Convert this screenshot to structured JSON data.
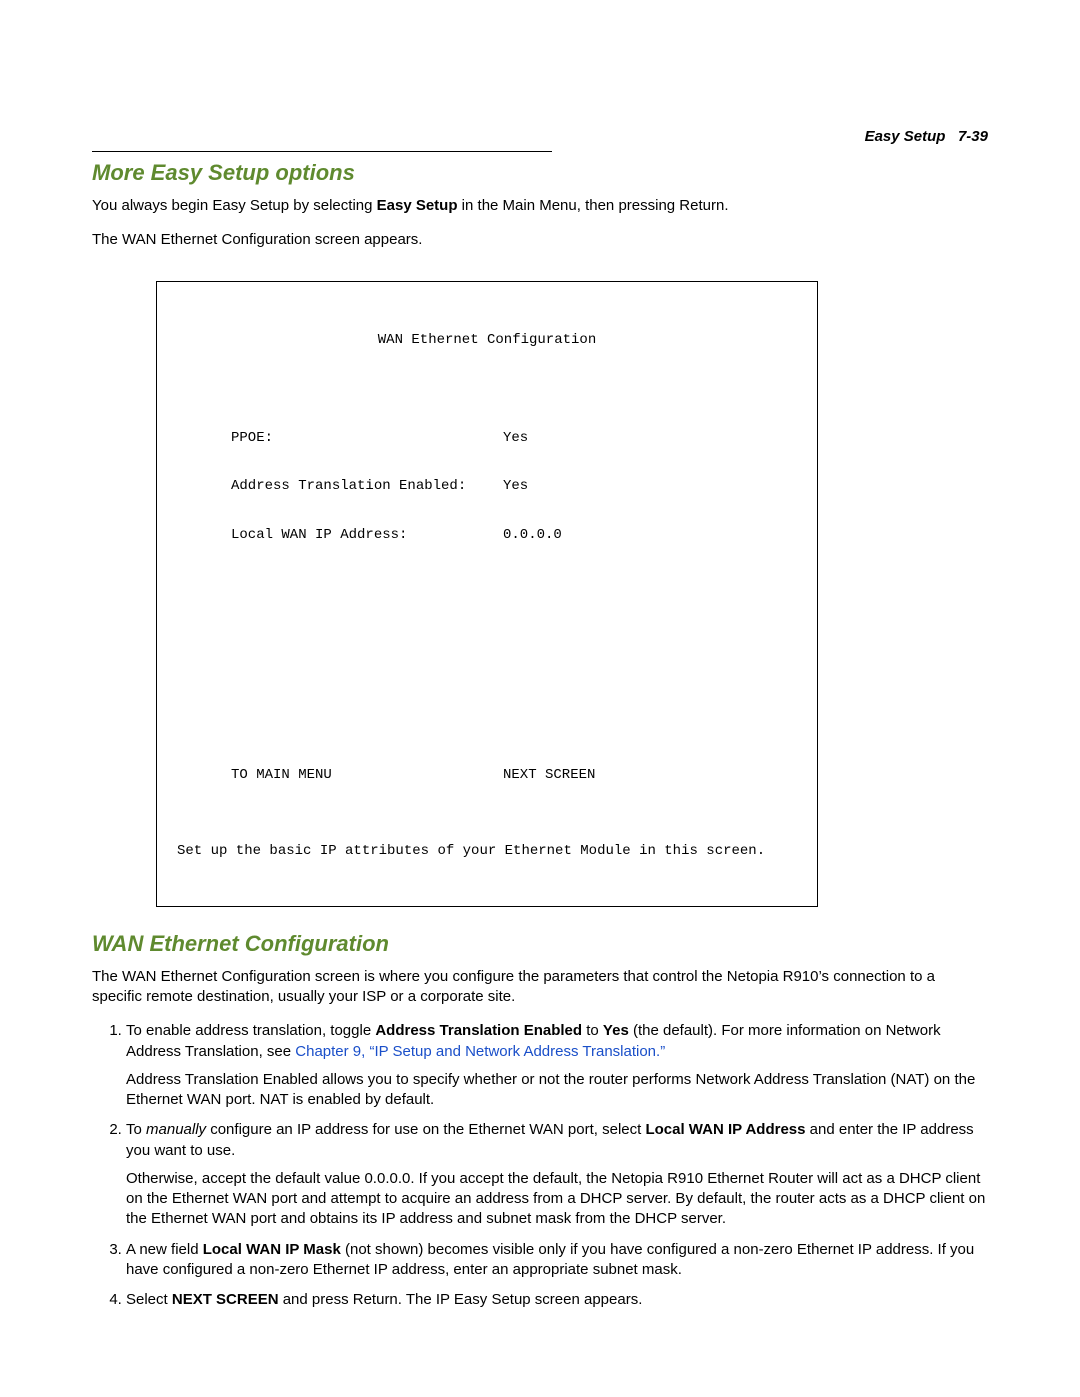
{
  "header": {
    "running_title": "Easy Setup",
    "page_ref": "7-39"
  },
  "section1": {
    "title": "More Easy Setup options",
    "p1a": "You always begin Easy Setup by selecting ",
    "p1b_bold": "Easy Setup",
    "p1c": " in the Main Menu, then pressing Return.",
    "p2": "The WAN Ethernet Configuration screen appears."
  },
  "terminal": {
    "title": "WAN Ethernet Configuration",
    "rows": [
      {
        "k": "PPOE:",
        "v": "Yes"
      },
      {
        "k": "Address Translation Enabled:",
        "v": "Yes"
      },
      {
        "k": "Local WAN IP Address:",
        "v": "0.0.0.0"
      }
    ],
    "nav_left": "TO MAIN MENU",
    "nav_right": "NEXT SCREEN",
    "footer": "Set up the basic IP attributes of your Ethernet Module in this screen."
  },
  "section2": {
    "title": "WAN Ethernet Configuration",
    "intro": "The WAN Ethernet Configuration screen is where you configure the parameters that control the Netopia R910’s connection to a specific remote destination, usually your ISP or a corporate site.",
    "item1": {
      "a": "To enable address translation, toggle ",
      "b_bold": "Address Translation Enabled",
      "c": " to ",
      "d_bold": "Yes",
      "e": " (the default). For more information on Network Address Translation, see ",
      "link": "Chapter 9, “IP Setup and Network Address Translation.”",
      "para2": "Address Translation Enabled allows you to specify whether or not the router performs Network Address Translation (NAT) on the Ethernet WAN port. NAT is enabled by default."
    },
    "item2": {
      "a": "To ",
      "b_italic": "manually",
      "c": " configure an IP address for use on the Ethernet WAN port, select ",
      "d_bold": "Local WAN IP Address",
      "e": " and enter the IP address you want to use.",
      "para2": "Otherwise, accept the default value 0.0.0.0. If you accept the default, the Netopia R910 Ethernet Router will act as a DHCP client on the Ethernet WAN port and attempt to acquire an address from a DHCP server. By default, the router acts as a DHCP client on the Ethernet WAN port and obtains its IP address and subnet mask from the DHCP server."
    },
    "item3": {
      "a": "A new field ",
      "b_bold": "Local WAN IP Mask",
      "c": " (not shown) becomes visible only if you have configured a non-zero Ethernet IP address. If you have configured a non-zero Ethernet IP address, enter an appropriate subnet mask."
    },
    "item4": {
      "a": "Select ",
      "b_bold": "NEXT SCREEN",
      "c": " and press Return. The IP Easy Setup screen appears."
    }
  }
}
